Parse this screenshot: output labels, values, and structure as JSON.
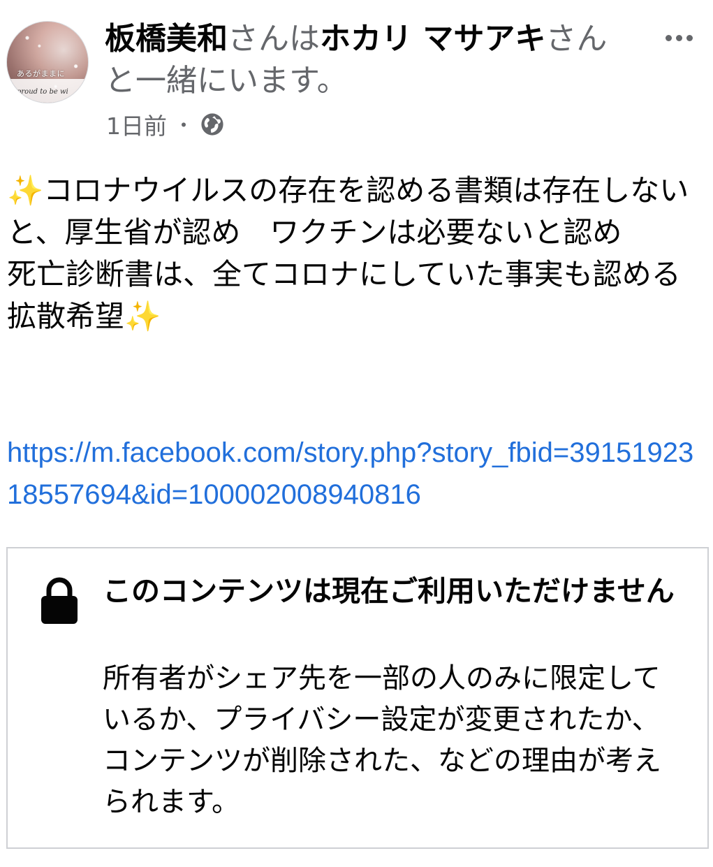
{
  "post": {
    "author": "板橋美和",
    "connector_1": "さんは",
    "tagged_user": "ホカリ マサアキ",
    "connector_2": "さんと一緒にいます。",
    "timestamp": "1日前",
    "separator": "・",
    "privacy_icon": "globe-icon",
    "more_icon": "more-horizontal-icon",
    "body_text": "✨コロナウイルスの存在を認める書類は存在しないと、厚生省が認め　ワクチンは必要ないと認め\n死亡診断書は、全てコロナにしていた事実も認める拡散希望✨",
    "link_text": "https://m.facebook.com/story.php?story_fbid=3915192318557694&id=100002008940816"
  },
  "avatar": {
    "text_top": "あるがままに",
    "text_bottom": "proud to be wi"
  },
  "unavailable_card": {
    "icon": "lock-icon",
    "title": "このコンテンツは現在ご利用いただけません",
    "description": "所有者がシェア先を一部の人のみに限定しているか、プライバシー設定が変更されたか、コンテンツが削除された、などの理由が考えられます。"
  },
  "colors": {
    "text_primary": "#050505",
    "text_secondary": "#65676b",
    "link": "#216fdb",
    "card_border": "#ced0d4"
  }
}
